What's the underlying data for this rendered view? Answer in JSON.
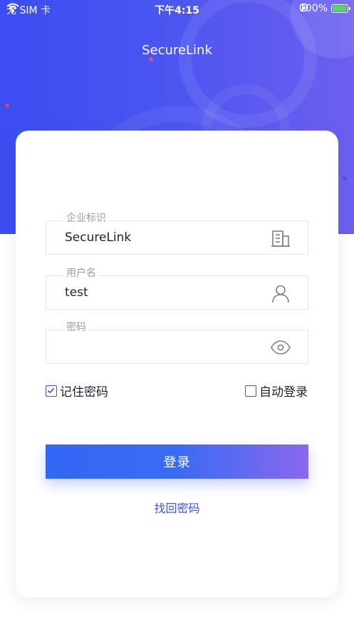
{
  "status_bar": {
    "carrier": "无 SIM 卡",
    "time": "下午4:15",
    "battery": "100%"
  },
  "header": {
    "title": "SecureLink"
  },
  "form": {
    "enterprise": {
      "label": "企业标识",
      "value": "SecureLink",
      "icon": "building-icon"
    },
    "username": {
      "label": "用户名",
      "value": "test",
      "icon": "user-icon"
    },
    "password": {
      "label": "密码",
      "value": "",
      "icon": "eye-icon"
    },
    "remember_password": {
      "label": "记住密码",
      "checked": true
    },
    "auto_login": {
      "label": "自动登录",
      "checked": false
    },
    "login_button": "登录",
    "forgot_password": "找回密码"
  },
  "colors": {
    "accent": "#3a55e8",
    "hero_gradient_start": "#3a4ef2",
    "hero_gradient_end": "#6d5ff1",
    "battery_green": "#4cd964"
  }
}
